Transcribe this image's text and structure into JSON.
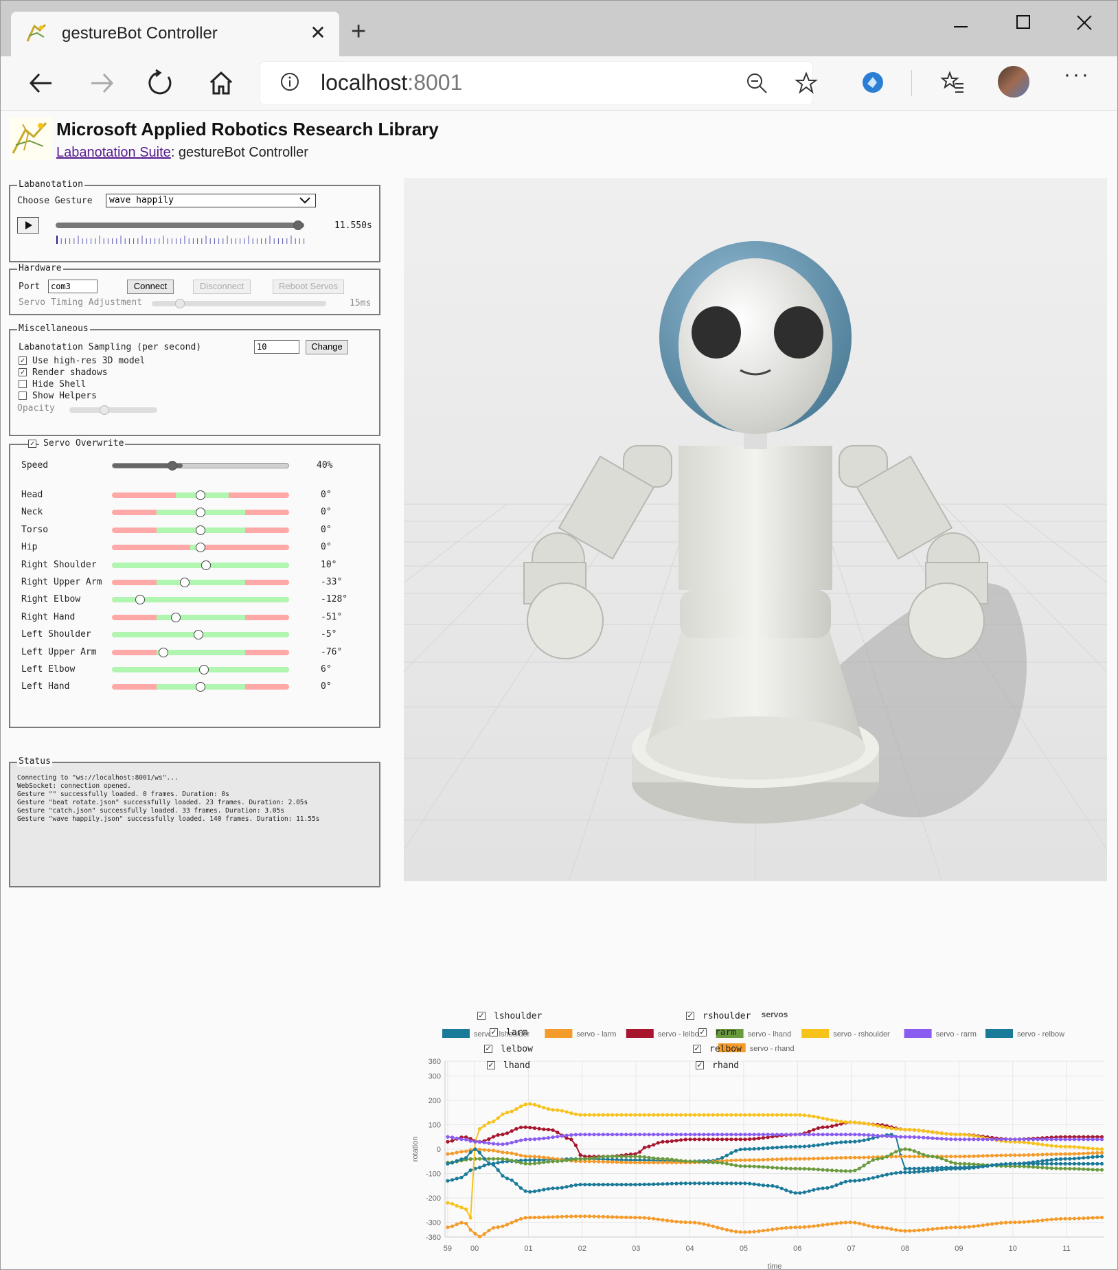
{
  "browser": {
    "tab_title": "gestureBot Controller",
    "url_host": "localhost",
    "url_port": ":8001"
  },
  "header": {
    "title": "Microsoft Applied Robotics Research Library",
    "link_text": "Labanotation Suite",
    "subtitle_rest": ": gestureBot Controller"
  },
  "labanotation": {
    "legend": "Labanotation",
    "choose_label": "Choose Gesture",
    "selected_gesture": "wave happily",
    "time": "11.550s",
    "play_icon": "play-icon",
    "playback_fraction": 1.0
  },
  "hardware": {
    "legend": "Hardware",
    "port_label": "Port",
    "port_value": "com3",
    "connect": "Connect",
    "disconnect": "Disconnect",
    "reboot": "Reboot Servos",
    "timing_label": "Servo Timing Adjustment",
    "timing_value": "15ms"
  },
  "misc": {
    "legend": "Miscellaneous",
    "sampling_label": "Labanotation Sampling (per second)",
    "sampling_value": "10",
    "change": "Change",
    "options": [
      {
        "label": "Use high-res 3D model",
        "checked": true
      },
      {
        "label": "Render shadows",
        "checked": true
      },
      {
        "label": "Hide Shell",
        "checked": false
      },
      {
        "label": "Show Helpers",
        "checked": false
      }
    ],
    "opacity_label": "Opacity"
  },
  "servo": {
    "legend": "Servo Overwrite",
    "enabled": true,
    "speed_label": "Speed",
    "speed_value": "40%",
    "joints": [
      {
        "name": "Head",
        "value": "0°"
      },
      {
        "name": "Neck",
        "value": "0°"
      },
      {
        "name": "Torso",
        "value": "0°"
      },
      {
        "name": "Hip",
        "value": "0°"
      },
      {
        "name": "Right Shoulder",
        "value": "10°"
      },
      {
        "name": "Right Upper Arm",
        "value": "-33°"
      },
      {
        "name": "Right Elbow",
        "value": "-128°"
      },
      {
        "name": "Right Hand",
        "value": "-51°"
      },
      {
        "name": "Left Shoulder",
        "value": "-5°"
      },
      {
        "name": "Left Upper Arm",
        "value": "-76°"
      },
      {
        "name": "Left Elbow",
        "value": "6°"
      },
      {
        "name": "Left Hand",
        "value": "0°"
      }
    ]
  },
  "status": {
    "legend": "Status",
    "log": "Connecting to \"ws://localhost:8001/ws\"...\nWebSocket: connection opened.\nGesture \"\" successfully loaded. 0 frames. Duration: 0s\nGesture \"beat rotate.json\" successfully loaded. 23 frames. Duration: 2.05s\nGesture \"catch.json\" successfully loaded. 33 frames. Duration: 3.05s\nGesture \"wave happily.json\" successfully loaded. 140 frames. Duration: 11.55s"
  },
  "chart_data": {
    "type": "line",
    "title": "servos",
    "xlabel": "time",
    "ylabel": "rotation",
    "x_ticks": [
      "59",
      "00",
      "01",
      "02",
      "03",
      "04",
      "05",
      "06",
      "07",
      "08",
      "09",
      "10",
      "11"
    ],
    "y_ticks": [
      360,
      300,
      200,
      100,
      0,
      -100,
      -200,
      -300,
      -360
    ],
    "ylim": [
      -360,
      360
    ],
    "xlim": [
      -0.55,
      11.7
    ],
    "grid": true,
    "legend_position": "top",
    "series": [
      {
        "name": "servo - lshoulder",
        "color": "#1a7a99",
        "x": [
          -0.5,
          -0.3,
          0,
          0.3,
          0.6,
          1,
          2,
          3,
          4,
          4.4,
          5,
          6,
          7,
          7.8,
          8,
          9,
          10,
          11,
          11.7
        ],
        "values": [
          -130,
          -120,
          -80,
          -60,
          -50,
          -45,
          -40,
          -45,
          -50,
          -48,
          0,
          10,
          30,
          60,
          -80,
          -75,
          -60,
          -40,
          -30
        ]
      },
      {
        "name": "servo - larm",
        "color": "#f39c2c",
        "x": [
          -0.5,
          -0.2,
          0,
          0.3,
          0.6,
          1,
          2,
          3,
          4,
          5,
          6,
          7,
          8,
          9,
          10,
          11,
          11.7
        ],
        "values": [
          -20,
          -10,
          0,
          -5,
          -15,
          -30,
          -50,
          -55,
          -55,
          -45,
          -40,
          -35,
          -30,
          -30,
          -25,
          -20,
          -15
        ]
      },
      {
        "name": "servo - lelbow",
        "color": "#a8162e",
        "x": [
          -0.5,
          -0.2,
          0.1,
          0.5,
          0.9,
          1.4,
          1.8,
          2,
          2.5,
          3,
          3.2,
          3.5,
          4,
          5,
          6,
          6.5,
          7,
          7.5,
          8,
          9,
          10,
          11,
          11.7
        ],
        "values": [
          30,
          50,
          30,
          60,
          90,
          80,
          40,
          -30,
          -30,
          -20,
          10,
          30,
          40,
          40,
          60,
          90,
          110,
          100,
          80,
          60,
          40,
          50,
          50
        ]
      },
      {
        "name": "servo - lhand",
        "color": "#6a9a3e",
        "x": [
          -0.5,
          0,
          0.5,
          1,
          1.5,
          2,
          2.5,
          3,
          3.5,
          4,
          4.5,
          5,
          6,
          7,
          7.5,
          8,
          8.5,
          9,
          10,
          11,
          11.7
        ],
        "values": [
          -55,
          -40,
          -40,
          -60,
          -50,
          -40,
          -30,
          -30,
          -40,
          -50,
          -55,
          -70,
          -80,
          -90,
          -40,
          0,
          -30,
          -60,
          -70,
          -80,
          -85
        ]
      },
      {
        "name": "servo - rshoulder",
        "color": "#f7c21c",
        "x": [
          -0.5,
          -0.2,
          0,
          0.02,
          0.05,
          0.3,
          0.6,
          1,
          1.5,
          2,
          3,
          4,
          5,
          6,
          7,
          8,
          9,
          10,
          11,
          11.7
        ],
        "values": [
          -220,
          -240,
          -300,
          360,
          80,
          110,
          150,
          185,
          160,
          140,
          140,
          140,
          140,
          140,
          110,
          80,
          60,
          30,
          10,
          0
        ]
      },
      {
        "name": "servo - rarm",
        "color": "#8a5cf0",
        "x": [
          -0.5,
          -0.2,
          0,
          0.5,
          1,
          2,
          3,
          4,
          5,
          6,
          7,
          8,
          9,
          10,
          11,
          11.7
        ],
        "values": [
          50,
          40,
          30,
          20,
          40,
          60,
          60,
          60,
          60,
          60,
          60,
          50,
          40,
          40,
          40,
          40
        ]
      },
      {
        "name": "servo - relbow",
        "color": "#1a7a99",
        "x": [
          -0.5,
          -0.2,
          0,
          0.3,
          0.6,
          1,
          1.5,
          2,
          3,
          4,
          5,
          5.5,
          6,
          6.5,
          7,
          8,
          9,
          10,
          11,
          11.7
        ],
        "values": [
          -60,
          -40,
          0,
          -60,
          -120,
          -175,
          -160,
          -145,
          -145,
          -140,
          -140,
          -150,
          -180,
          -160,
          -130,
          -95,
          -80,
          -60,
          -60,
          -60
        ]
      },
      {
        "name": "servo - rhand",
        "color": "#f39c2c",
        "x": [
          -0.5,
          -0.2,
          0,
          0.05,
          0.4,
          1,
          2,
          3,
          4,
          5,
          6,
          7,
          7.5,
          8,
          9,
          10,
          11,
          11.7
        ],
        "values": [
          -320,
          -300,
          -345,
          -360,
          -320,
          -280,
          -275,
          -280,
          -300,
          -340,
          -320,
          -300,
          -320,
          -335,
          -320,
          -300,
          -285,
          -280
        ]
      }
    ]
  },
  "series_checkboxes": {
    "left": [
      {
        "label": "lshoulder",
        "checked": true
      },
      {
        "label": "larm",
        "checked": true
      },
      {
        "label": "lelbow",
        "checked": true
      },
      {
        "label": "lhand",
        "checked": true
      }
    ],
    "right": [
      {
        "label": "rshoulder",
        "checked": true
      },
      {
        "label": "rarm",
        "checked": true
      },
      {
        "label": "relbow",
        "checked": true
      },
      {
        "label": "rhand",
        "checked": true
      }
    ]
  }
}
